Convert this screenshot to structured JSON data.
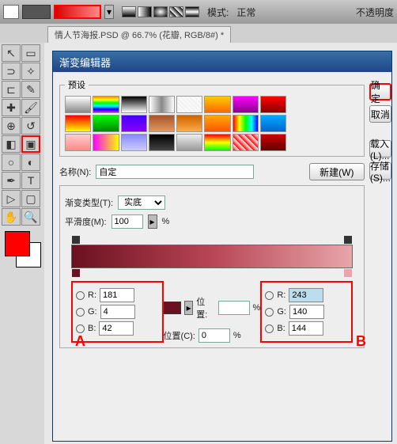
{
  "topbar": {
    "mode": "模式:",
    "param": "正常",
    "opacity": "不透明度"
  },
  "tab": {
    "label": "情人节海报.PSD @ 66.7% (花瓣, RGB/8#) *"
  },
  "dialog": {
    "title": "渐变编辑器",
    "presets_label": "预设",
    "ok": "确定",
    "cancel": "取消",
    "load": "载入(L)...",
    "save": "存储(S)...",
    "name_label": "名称(N):",
    "name_value": "自定",
    "new": "新建(W)",
    "type_label": "渐变类型(T):",
    "type_value": "实底",
    "smooth_label": "平滑度(M):",
    "smooth_value": "100",
    "pct": "%",
    "pos_label": "位置:",
    "pos2_label": "位置(C):",
    "pos2_value": "0"
  },
  "colorA": {
    "R": "181",
    "G": "4",
    "B": "42"
  },
  "colorB": {
    "R": "243",
    "G": "140",
    "B": "144"
  },
  "markers": {
    "A": "A",
    "B": "B"
  },
  "presets": [
    "linear-gradient(#fff,#888)",
    "linear-gradient(#f80,#ff0,#0f0,#0ff,#00f,#f0f)",
    "linear-gradient(#000,#fff)",
    "linear-gradient(90deg,#fff,#888,#fff)",
    "repeating-linear-gradient(45deg,#eee,#fff 4px)",
    "linear-gradient(#fc0,#f60)",
    "linear-gradient(#f0f,#808)",
    "linear-gradient(#f00,#800)",
    "linear-gradient(#f00,#ff0)",
    "linear-gradient(#0f0,#080)",
    "linear-gradient(#40f,#80f)",
    "linear-gradient(#a52,#d96)",
    "linear-gradient(#c60,#fa4)",
    "linear-gradient(#fa0,#f50)",
    "linear-gradient(90deg,#f00,#ff0,#0f0,#0ff,#00f)",
    "linear-gradient(#0af,#06c)",
    "linear-gradient(#fcc,#f88)",
    "linear-gradient(90deg,#f0f,#ff0)",
    "linear-gradient(#88f,#ccf)",
    "linear-gradient(#000,#444)",
    "linear-gradient(#eee,#999)",
    "linear-gradient(#f00,#ff0,#0f0)",
    "repeating-linear-gradient(45deg,#f00,#fff 6px)",
    "linear-gradient(#c00,#600)"
  ]
}
